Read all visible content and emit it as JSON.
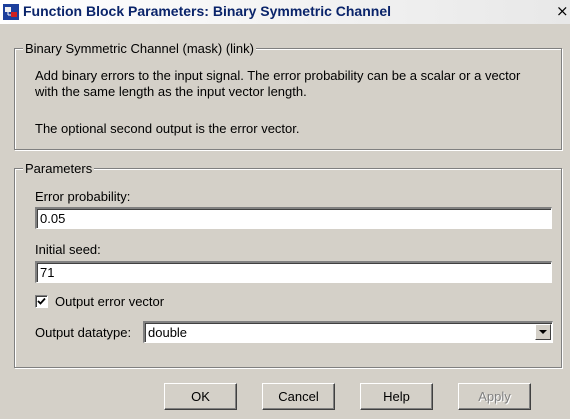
{
  "window": {
    "title": "Function Block Parameters: Binary Symmetric Channel",
    "close_glyph": "×"
  },
  "mask_group": {
    "legend": "Binary Symmetric Channel (mask) (link)",
    "description_lines": [
      "Add binary errors to the input signal. The error probability can be a scalar or a vector",
      "with the same length as the input vector length."
    ],
    "note": "The optional second output is the error vector."
  },
  "parameters": {
    "legend": "Parameters",
    "error_probability": {
      "label": "Error probability:",
      "value": "0.05"
    },
    "initial_seed": {
      "label": "Initial seed:",
      "value": "71"
    },
    "output_error_vector": {
      "label": "Output error vector",
      "checked": true
    },
    "output_datatype": {
      "label": "Output datatype:",
      "value": "double"
    }
  },
  "buttons": {
    "ok": "OK",
    "cancel": "Cancel",
    "help": "Help",
    "apply": "Apply"
  },
  "icons": {
    "window": "simulink-block-icon",
    "close": "close-icon",
    "check": "checkmark-icon",
    "dropdown": "chevron-down-icon"
  }
}
